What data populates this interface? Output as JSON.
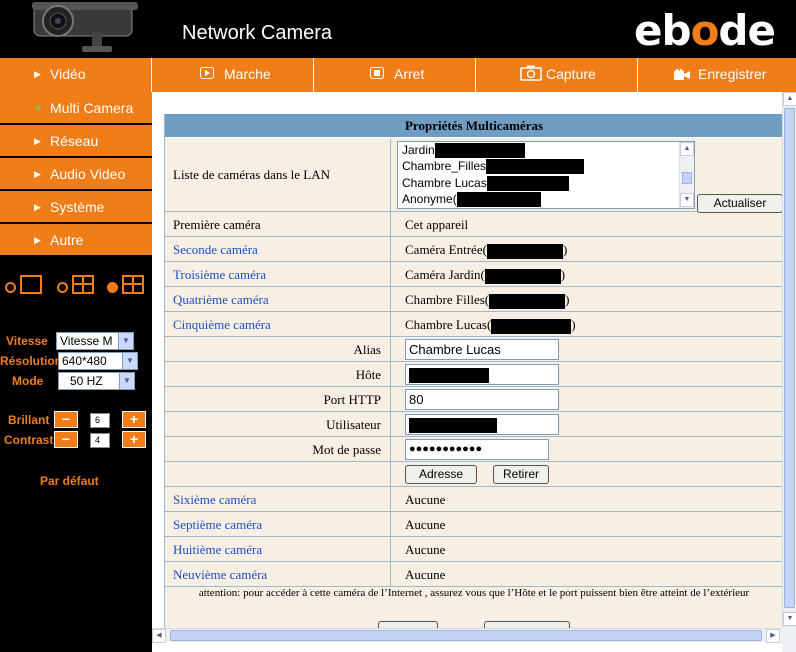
{
  "header": {
    "app_title": "Network Camera",
    "brand_pre": "eb",
    "brand_o": "o",
    "brand_post": "de"
  },
  "toolbar": {
    "play": "Marche",
    "stop": "Arret",
    "capture": "Capture",
    "record": "Enregistrer"
  },
  "sidebar": {
    "items": [
      {
        "label": "Vidéo",
        "active": false
      },
      {
        "label": "Multi Camera",
        "active": true
      },
      {
        "label": "Réseau",
        "active": false
      },
      {
        "label": "Audio Video",
        "active": false
      },
      {
        "label": "Système",
        "active": false
      },
      {
        "label": "Autre",
        "active": false
      }
    ],
    "controls": {
      "vitesse_label": "Vitesse",
      "vitesse_value": "Vitesse M",
      "resolution_label": "Résolution",
      "resolution_value": "640*480",
      "mode_label": "Mode",
      "mode_value": "50 HZ",
      "brillant_label": "Brillant",
      "brillant_value": "6",
      "contrast_label": "Contrast",
      "contrast_value": "4",
      "default_label": "Par défaut"
    }
  },
  "panel": {
    "title": "Propriétés Multicaméras",
    "lan_label": "Liste de caméras dans le LAN",
    "lan_list": [
      "Jardin",
      "Chambre_Filles",
      "Chambre Lucas",
      "Anonyme("
    ],
    "refresh_button": "Actualiser",
    "cameras": [
      {
        "label": "Première caméra",
        "value": "Cet appareil"
      },
      {
        "label": "Seconde caméra",
        "value": "Caméra Entrée("
      },
      {
        "label": "Troisième caméra",
        "value": "Caméra Jardin("
      },
      {
        "label": "Quatrième caméra",
        "value": "Chambre Filles("
      },
      {
        "label": "Cinquième caméra",
        "value": "Chambre Lucas("
      }
    ],
    "form": {
      "alias_label": "Alias",
      "alias_value": "Chambre Lucas",
      "host_label": "Hôte",
      "port_label": "Port HTTP",
      "port_value": "80",
      "user_label": "Utilisateur",
      "password_label": "Mot de passe",
      "password_value": "●●●●●●●●●●●",
      "add_button": "Adresse",
      "remove_button": "Retirer"
    },
    "more_cameras": [
      {
        "label": "Sixième caméra",
        "value": "Aucune"
      },
      {
        "label": "Septième caméra",
        "value": "Aucune"
      },
      {
        "label": "Huitième caméra",
        "value": "Aucune"
      },
      {
        "label": "Neuvième caméra",
        "value": "Aucune"
      }
    ],
    "warning": "attention: pour accéder à cette caméra de l’Internet , assurez vous que l’Hôte et le port puissent bien être atteint de l’extérieur"
  },
  "colors": {
    "accent": "#f07d18",
    "table_header": "#6f9dc2",
    "link": "#1d4fc4",
    "row_bg": "#f7efe3"
  }
}
